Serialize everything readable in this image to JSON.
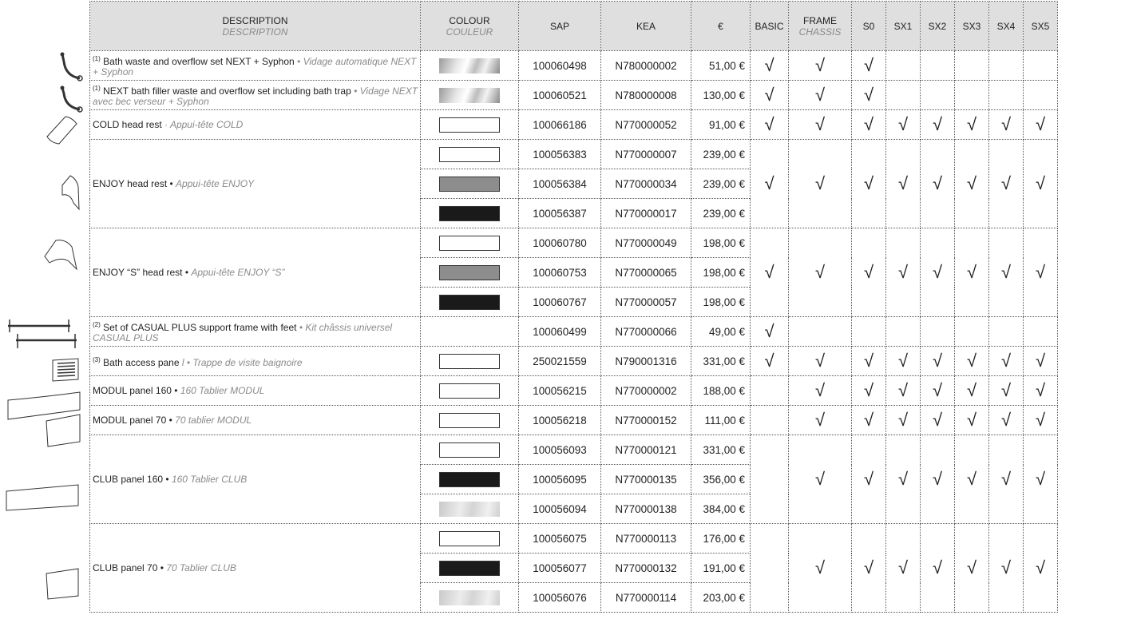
{
  "headers": {
    "description": "DESCRIPTION",
    "description_fr": "DESCRIPTION",
    "colour": "COLOUR",
    "colour_fr": "COULEUR",
    "sap": "SAP",
    "kea": "KEA",
    "price": "€",
    "basic": "BASIC",
    "frame": "FRAME",
    "frame_fr": "CHASSIS",
    "s0": "S0",
    "sx1": "SX1",
    "sx2": "SX2",
    "sx3": "SX3",
    "sx4": "SX4",
    "sx5": "SX5"
  },
  "check_glyph": "√",
  "products": [
    {
      "note": "(1)",
      "en": "Bath waste and overflow set NEXT + Syphon",
      "fr": "• Vidage automati­que NEXT + Syphon",
      "icon": "bath-waste-icon",
      "checks": [
        1,
        1,
        1,
        0,
        0,
        0,
        0,
        0
      ],
      "variants": [
        {
          "colour": "chrome",
          "sap": "100060498",
          "kea": "N780000002",
          "price": "51,00 €"
        }
      ]
    },
    {
      "note": "(1)",
      "en": "NEXT bath filler waste and overflow set including bath trap",
      "fr": "• Vidage NEXT avec bec verseur + Syphon",
      "icon": "bath-filler-icon",
      "checks": [
        1,
        1,
        1,
        0,
        0,
        0,
        0,
        0
      ],
      "variants": [
        {
          "colour": "chrome",
          "sap": "100060521",
          "kea": "N780000008",
          "price": "130,00 €"
        }
      ]
    },
    {
      "note": "",
      "en": "COLD head rest",
      "fr": "· Appui-tête COLD",
      "icon": "cold-head-rest-icon",
      "checks": [
        1,
        1,
        1,
        1,
        1,
        1,
        1,
        1
      ],
      "variants": [
        {
          "colour": "white",
          "sap": "100066186",
          "kea": "N770000052",
          "price": "91,00 €"
        }
      ]
    },
    {
      "note": "",
      "en": "ENJOY head rest •",
      "fr": "Appui-tête ENJOY",
      "icon": "enjoy-head-rest-icon",
      "checks": [
        1,
        1,
        1,
        1,
        1,
        1,
        1,
        1
      ],
      "variants": [
        {
          "colour": "white",
          "sap": "100056383",
          "kea": "N770000007",
          "price": "239,00 €"
        },
        {
          "colour": "grey",
          "sap": "100056384",
          "kea": "N770000034",
          "price": "239,00 €"
        },
        {
          "colour": "black",
          "sap": "100056387",
          "kea": "N770000017",
          "price": "239,00 €"
        }
      ]
    },
    {
      "note": "",
      "en": "ENJOY “S” head rest •",
      "fr": "Appui-tête ENJOY “S”",
      "icon": "enjoy-s-head-rest-icon",
      "checks": [
        1,
        1,
        1,
        1,
        1,
        1,
        1,
        1
      ],
      "variants": [
        {
          "colour": "white",
          "sap": "100060780",
          "kea": "N770000049",
          "price": "198,00 €"
        },
        {
          "colour": "grey",
          "sap": "100060753",
          "kea": "N770000065",
          "price": "198,00 €"
        },
        {
          "colour": "black",
          "sap": "100060767",
          "kea": "N770000057",
          "price": "198,00 €"
        }
      ]
    },
    {
      "note": "(2)",
      "en": "Set of CASUAL PLUS support frame with feet",
      "fr": "• Kit châssis universel CASUAL PLUS",
      "icon": "support-frame-icon",
      "checks": [
        1,
        0,
        0,
        0,
        0,
        0,
        0,
        0
      ],
      "variants": [
        {
          "colour": "none",
          "sap": "100060499",
          "kea": "N770000066",
          "price": "49,00 €"
        }
      ]
    },
    {
      "note": "(3)",
      "en": "Bath access pane",
      "fr": "l • Trappe de visite baignoire",
      "icon": "access-panel-icon",
      "checks": [
        1,
        1,
        1,
        1,
        1,
        1,
        1,
        1
      ],
      "variants": [
        {
          "colour": "white",
          "sap": "250021559",
          "kea": "N790001316",
          "price": "331,00 €"
        }
      ]
    },
    {
      "note": "",
      "en": "MODUL panel 160 •",
      "fr": "160 Tablier MODUL",
      "icon": "modul-panel-160-icon",
      "checks": [
        0,
        1,
        1,
        1,
        1,
        1,
        1,
        1
      ],
      "variants": [
        {
          "colour": "white",
          "sap": "100056215",
          "kea": "N770000002",
          "price": "188,00 €"
        }
      ]
    },
    {
      "note": "",
      "en": "MODUL panel 70 •",
      "fr": "70 tablier MODUL",
      "icon": "modul-panel-70-icon",
      "checks": [
        0,
        1,
        1,
        1,
        1,
        1,
        1,
        1
      ],
      "variants": [
        {
          "colour": "white",
          "sap": "100056218",
          "kea": "N770000152",
          "price": "111,00 €"
        }
      ]
    },
    {
      "note": "",
      "en": "CLUB panel 160 •",
      "fr": "160 Tablier CLUB",
      "icon": "club-panel-160-icon",
      "checks": [
        0,
        1,
        1,
        1,
        1,
        1,
        1,
        1
      ],
      "variants": [
        {
          "colour": "white",
          "sap": "100056093",
          "kea": "N770000121",
          "price": "331,00 €"
        },
        {
          "colour": "black",
          "sap": "100056095",
          "kea": "N770000135",
          "price": "356,00 €"
        },
        {
          "colour": "steel",
          "sap": "100056094",
          "kea": "N770000138",
          "price": "384,00 €"
        }
      ]
    },
    {
      "note": "",
      "en": "CLUB panel 70 •",
      "fr": "70 Tablier CLUB",
      "icon": "club-panel-70-icon",
      "checks": [
        0,
        1,
        1,
        1,
        1,
        1,
        1,
        1
      ],
      "variants": [
        {
          "colour": "white",
          "sap": "100056075",
          "kea": "N770000113",
          "price": "176,00 €"
        },
        {
          "colour": "black",
          "sap": "100056077",
          "kea": "N770000132",
          "price": "191,00 €"
        },
        {
          "colour": "steel",
          "sap": "100056076",
          "kea": "N770000114",
          "price": "203,00 €"
        }
      ]
    }
  ]
}
